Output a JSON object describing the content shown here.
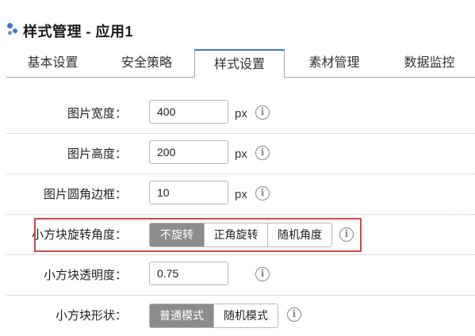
{
  "header": {
    "title": "样式管理 - 应用1"
  },
  "tabs": [
    {
      "label": "基本设置"
    },
    {
      "label": "安全策略"
    },
    {
      "label": "样式设置"
    },
    {
      "label": "素材管理"
    },
    {
      "label": "数据监控"
    }
  ],
  "active_tab": "样式设置",
  "form": {
    "width": {
      "label": "图片宽度：",
      "value": "400",
      "unit": "px"
    },
    "height": {
      "label": "图片高度：",
      "value": "200",
      "unit": "px"
    },
    "radius": {
      "label": "图片圆角边框：",
      "value": "10",
      "unit": "px"
    },
    "rotation": {
      "label": "小方块旋转角度：",
      "options": [
        "不旋转",
        "正角旋转",
        "随机角度"
      ],
      "selected": "不旋转"
    },
    "opacity": {
      "label": "小方块透明度：",
      "value": "0.75"
    },
    "shape": {
      "label": "小方块形状：",
      "options": [
        "普通模式",
        "随机模式"
      ],
      "selected": "普通模式"
    }
  },
  "colors": {
    "accent": "#3c78c8",
    "selected_segment": "#8c8c8c",
    "highlight_border": "#d8474b"
  },
  "icons": {
    "logo": "dots-logo-icon",
    "info": "info-circle-icon"
  }
}
